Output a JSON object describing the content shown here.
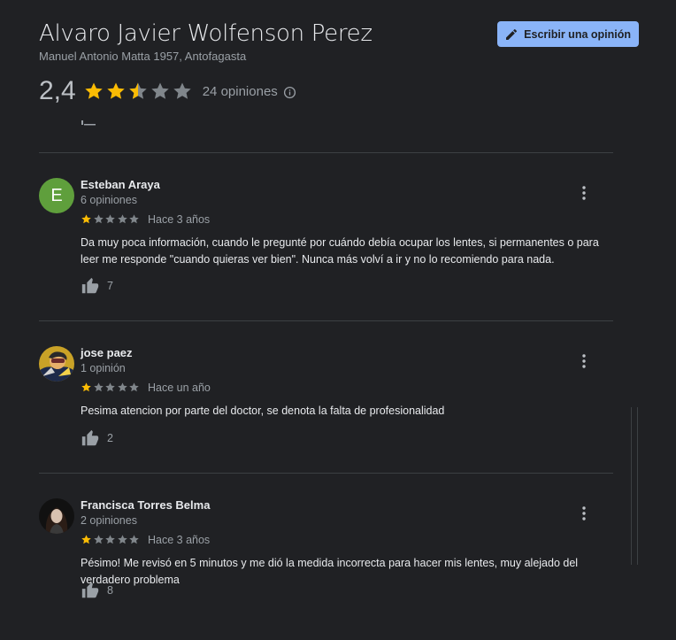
{
  "business": {
    "name": "Alvaro Javier Wolfenson Perez",
    "address": "Manuel Antonio Matta 1957, Antofagasta",
    "rating": "2,4",
    "rating_value": 2.4,
    "review_count": "24 opiniones"
  },
  "write_review_button": {
    "label": "Escribir una opinión",
    "icon": "pencil-icon"
  },
  "colors": {
    "star_filled": "#fbbc04",
    "star_empty": "#80868b",
    "accent": "#8ab4f8",
    "background": "#202124"
  },
  "reviews": [
    {
      "name": "Esteban Araya",
      "count": "6 opiniones",
      "avatar": "E",
      "rating": 1,
      "time": "Hace 3 años",
      "text": "Da muy poca información, cuando le pregunté por cuándo debía ocupar los lentes, si permanentes o para leer me responde \"cuando quieras ver bien\". Nunca más volví a ir y no lo recomiendo para nada.",
      "likes": "7"
    },
    {
      "name": "jose paez",
      "count": "1 opinión",
      "rating": 1,
      "time": "Hace un año",
      "text": "Pesima atencion por parte del doctor, se denota la falta de profesionalidad",
      "likes": "2"
    },
    {
      "name": "Francisca Torres Belma",
      "count": "2 opiniones",
      "rating": 1,
      "time": "Hace 3 años",
      "text": "Pésimo! Me revisó en 5 minutos y me dió la medida incorrecta para hacer mis lentes, muy alejado del verdadero problema",
      "likes": "8"
    }
  ]
}
